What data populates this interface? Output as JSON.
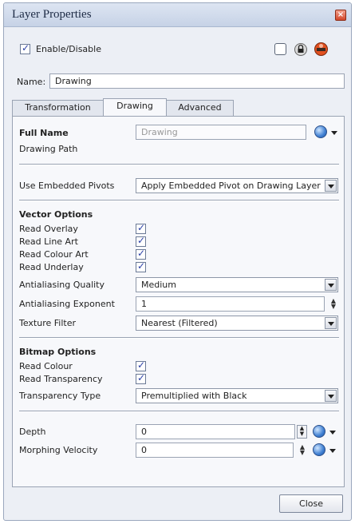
{
  "window": {
    "title": "Layer Properties"
  },
  "header": {
    "enable_label": "Enable/Disable",
    "enable_checked": true
  },
  "name_field": {
    "label": "Name:",
    "value": "Drawing"
  },
  "tabs": [
    {
      "label": "Transformation",
      "active": false
    },
    {
      "label": "Drawing",
      "active": true
    },
    {
      "label": "Advanced",
      "active": false
    }
  ],
  "drawing": {
    "full_name_label": "Full Name",
    "full_name_value": "Drawing",
    "drawing_path_label": "Drawing Path",
    "pivots_label": "Use Embedded Pivots",
    "pivots_value": "Apply Embedded Pivot on Drawing Layer"
  },
  "vector": {
    "heading": "Vector Options",
    "read_overlay": "Read Overlay",
    "read_line_art": "Read Line Art",
    "read_colour_art": "Read Colour Art",
    "read_underlay": "Read Underlay",
    "antialiasing_quality_label": "Antialiasing Quality",
    "antialiasing_quality_value": "Medium",
    "antialiasing_exponent_label": "Antialiasing Exponent",
    "antialiasing_exponent_value": "1",
    "texture_filter_label": "Texture Filter",
    "texture_filter_value": "Nearest (Filtered)"
  },
  "bitmap": {
    "heading": "Bitmap Options",
    "read_colour": "Read Colour",
    "read_transparency": "Read Transparency",
    "transparency_type_label": "Transparency Type",
    "transparency_type_value": "Premultiplied with Black"
  },
  "misc": {
    "depth_label": "Depth",
    "depth_value": "0",
    "morphing_label": "Morphing Velocity",
    "morphing_value": "0"
  },
  "footer": {
    "close_label": "Close"
  },
  "colors": {
    "accent": "#2a3fa6",
    "titlebar": "#c6d2e6",
    "window_bg": "#eceff5"
  }
}
